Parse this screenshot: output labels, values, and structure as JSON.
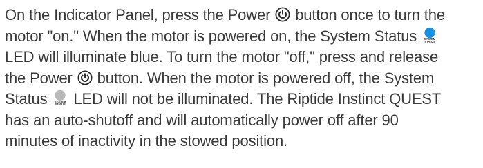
{
  "paragraph": {
    "line1": {
      "a": "On the Indicator Panel, press the Power",
      "b": "button once to turn the"
    },
    "line2": {
      "a": "motor \"on.\" When the motor is powered on, the System Status"
    },
    "line3": {
      "a": "LED will illuminate blue. To turn the motor \"off,\" press and release"
    },
    "line4": {
      "a": "the Power",
      "b": "button. When the motor is powered off, the System"
    },
    "line5": {
      "a": "Status",
      "b": "LED will not be illuminated. The Riptide Instinct QUEST"
    },
    "line6": {
      "a": "has an auto-shutoff and will automatically power off after 90"
    },
    "line7": {
      "a": "minutes of inactivity in the stowed position."
    }
  },
  "icons": {
    "power": "power-icon",
    "led_on": "system-status-led-on-icon",
    "led_off": "system-status-led-off-icon",
    "led_caption": "SYSTEM STATUS"
  },
  "colors": {
    "led_on": "#1a8fe0",
    "led_off": "#b9b9b9",
    "text": "#3a3a3a"
  }
}
